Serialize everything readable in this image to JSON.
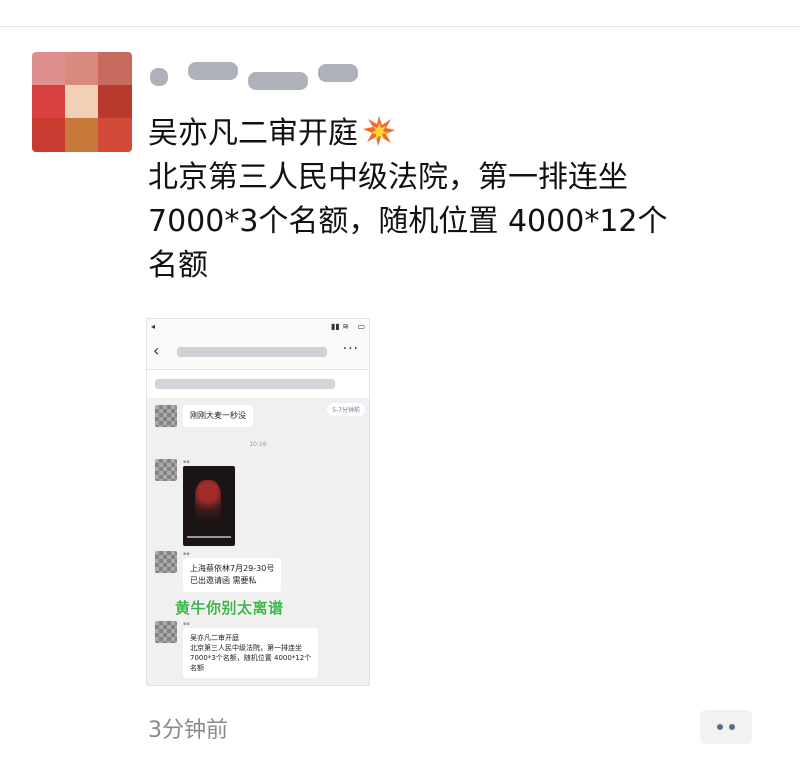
{
  "post": {
    "lines": [
      "吴亦凡二审开庭",
      "北京第三人民中级法院，第一排连坐",
      "7000*3个名额，随机位置 4000*12个",
      "名额"
    ],
    "time": "3分钟前"
  },
  "screenshot": {
    "notice_pill": "5-7分钟前",
    "msg1": "刚刚大麦一秒没",
    "timestamp": "10:16",
    "msg3_line1": "上海蔡依林7月29-30号",
    "msg3_line2": "已出邀请函 需要私",
    "overlay_caption": "黄牛你别太离谱",
    "msg4_line1": "吴亦凡二审开庭",
    "msg4_line2": "北京第三人民中级法院，第一排连坐",
    "msg4_line3": "7000*3个名额，随机位置 4000*12个",
    "msg4_line4": "名额"
  },
  "colors": {
    "accent_green": "#3cb54a",
    "link_blue": "#5a6b8c",
    "timestamp_gray": "#8a8a8a"
  },
  "icons": [
    "collision-emoji-icon",
    "more-dots-icon",
    "back-arrow-icon"
  ]
}
